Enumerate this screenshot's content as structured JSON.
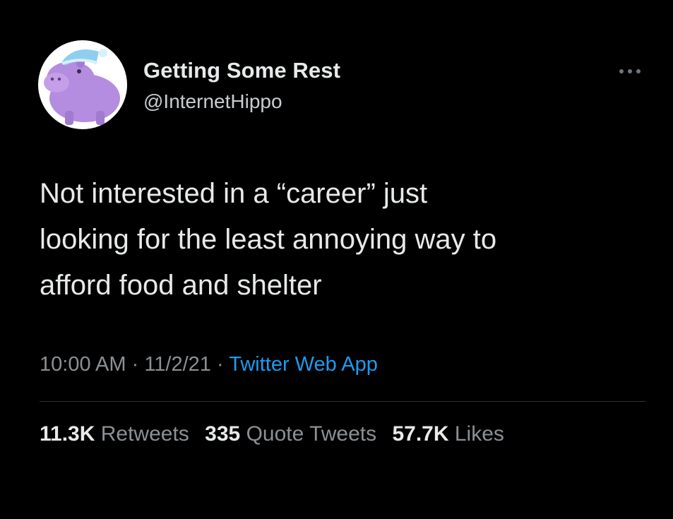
{
  "user": {
    "display_name": "Getting Some Rest",
    "handle": "@InternetHippo",
    "avatar_icon": "purple-hippo-sleeping-cap-icon"
  },
  "tweet": {
    "text_lines": [
      "Not interested in a “career” just",
      "looking for the least annoying way to",
      "afford food and shelter"
    ]
  },
  "meta": {
    "time": "10:00 AM",
    "separator": "·",
    "date": "11/2/21",
    "source": "Twitter Web App"
  },
  "stats": {
    "retweets_count": "11.3K",
    "retweets_label": "Retweets",
    "quote_count": "335",
    "quote_label": "Quote Tweets",
    "likes_count": "57.7K",
    "likes_label": "Likes"
  },
  "colors": {
    "background": "#000000",
    "text_primary": "#e7e9ea",
    "text_secondary": "#8b9095",
    "link": "#1d9bf0",
    "avatar_hippo": "#b48ce0",
    "avatar_cap": "#8ecff0"
  }
}
